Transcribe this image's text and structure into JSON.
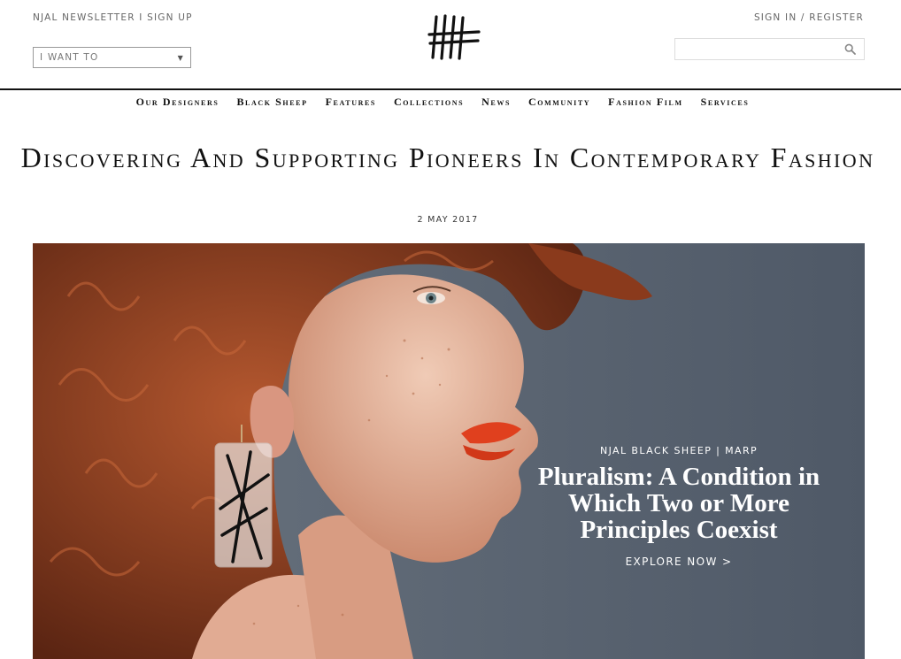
{
  "header": {
    "newsletter_link": "NJAL NEWSLETTER",
    "separator": " I ",
    "signup_link": "SIGN UP",
    "signin_link": "SIGN IN",
    "auth_separator": " / ",
    "register_link": "REGISTER",
    "i_want_to": "I WANT TO",
    "search_placeholder": ""
  },
  "nav": {
    "items": [
      {
        "label": "Our Designers"
      },
      {
        "label": "Black Sheep"
      },
      {
        "label": "Features"
      },
      {
        "label": "Collections"
      },
      {
        "label": "News"
      },
      {
        "label": "Community"
      },
      {
        "label": "Fashion Film"
      },
      {
        "label": "Services"
      }
    ]
  },
  "main": {
    "headline": "Discovering And Supporting Pioneers In Contemporary Fashion",
    "date": "2 MAY 2017"
  },
  "hero": {
    "kicker": "NJAL BLACK SHEEP | MARP",
    "title": "Pluralism: A Condition in Which Two or More Principles Coexist",
    "cta": "EXPLORE NOW >"
  },
  "colors": {
    "hero_background": "#5a6573",
    "hair": "#9a4a28",
    "skin": "#e6b8a0",
    "lips": "#e0401e"
  },
  "icons": [
    "logo-icon",
    "chevron-down-icon",
    "search-icon"
  ]
}
